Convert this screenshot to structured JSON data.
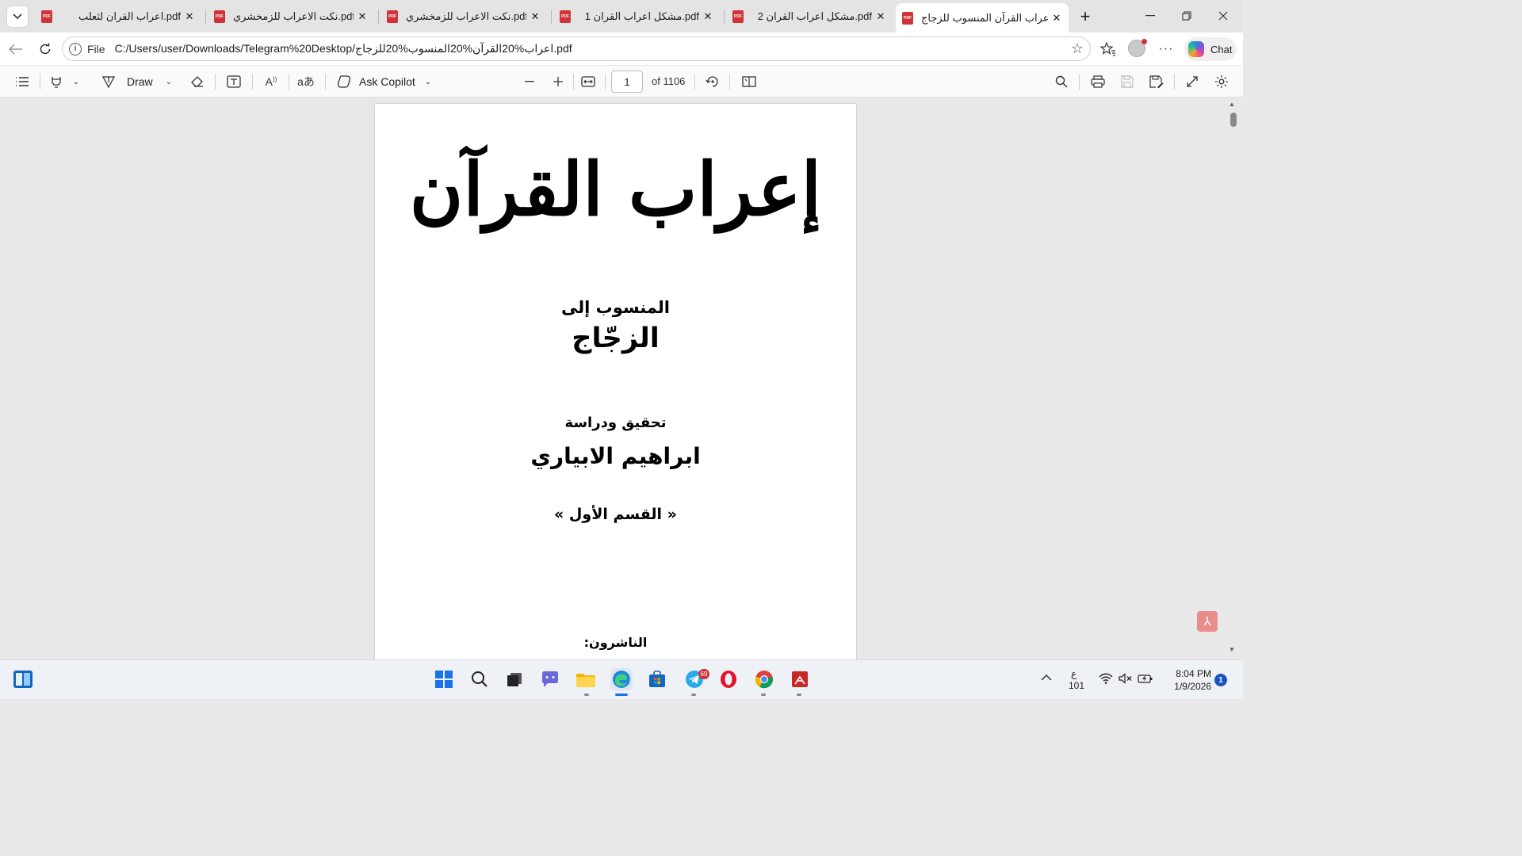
{
  "browser": {
    "tabs": [
      {
        "title": "اعراب القرآن المنسوب للزجاج.pdf",
        "active": true
      },
      {
        "title": "مشكل اعراب القران 2.pdf",
        "active": false
      },
      {
        "title": "مشكل اعراب القران 1.pdf",
        "active": false
      },
      {
        "title": "نكت الاعراب للزمخشري.pdf",
        "active": false
      },
      {
        "title": "نكت الاعراب للزمخشري.pdf",
        "active": false
      },
      {
        "title": "اعراب القران لثعلب.pdf",
        "active": false
      }
    ],
    "address": {
      "scheme_label": "File",
      "url": "C:/Users/user/Downloads/Telegram%20Desktop/اعراب%20القرآن%20المنسوب%20للزجاج.pdf"
    },
    "chat_label": "Chat"
  },
  "pdf_toolbar": {
    "draw_label": "Draw",
    "ask_copilot_label": "Ask Copilot",
    "page_number": "1",
    "page_count_label": "of 1106"
  },
  "document": {
    "title": "إعراب القرآن",
    "attributed_to": "المنسوب إلى",
    "author": "الزجّاج",
    "editing_label": "تحقيق ودراسة",
    "editor": "ابراهيم الابياري",
    "part": "« القسم الأول »",
    "publishers_label": "الناشرون:"
  },
  "taskbar": {
    "telegram_badge": "69",
    "ime_indicator": "ع",
    "ime_sub": "101",
    "time": "8:04 PM",
    "date": "1/9/2026",
    "notification_count": "1"
  },
  "icons": {
    "tab_icon": "pdf-file-icon",
    "accent": "#1a73e8",
    "pdf_red": "#d13438"
  }
}
